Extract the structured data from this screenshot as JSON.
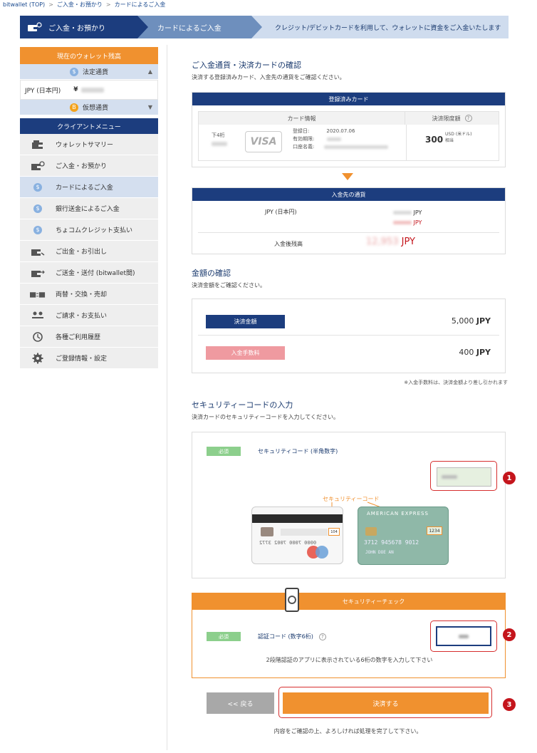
{
  "breadcrumb": {
    "items": [
      "bitwallet (TOP)",
      "ご入金・お預かり",
      "カードによるご入金"
    ]
  },
  "steps": {
    "step1": "ご入金・お預かり",
    "step2": "カードによるご入金",
    "step3": "クレジット/デビットカードを利用して、ウォレットに資金をご入金いたします"
  },
  "sidebar": {
    "balance_title": "現在のウォレット残高",
    "fiat_label": "法定通貨",
    "fiat_currency": "JPY (日本円)",
    "fiat_prefix": "¥",
    "crypto_label": "仮想通貨",
    "menu_title": "クライアントメニュー",
    "items": [
      {
        "label": "ウォレットサマリー",
        "icon": "wallet-icon"
      },
      {
        "label": "ご入金・お預かり",
        "icon": "deposit-icon"
      },
      {
        "label": "カードによるご入金",
        "icon": "coin-icon"
      },
      {
        "label": "銀行送金によるご入金",
        "icon": "coin-icon"
      },
      {
        "label": "ちょコムクレジット支払い",
        "icon": "coin-icon"
      },
      {
        "label": "ご出金・お引出し",
        "icon": "withdraw-icon"
      },
      {
        "label": "ご送金・送付 (bitwallet間)",
        "icon": "transfer-icon"
      },
      {
        "label": "両替・交換・売却",
        "icon": "exchange-icon"
      },
      {
        "label": "ご請求・お支払い",
        "icon": "users-icon"
      },
      {
        "label": "各種ご利用履歴",
        "icon": "history-icon"
      },
      {
        "label": "ご登録情報・設定",
        "icon": "gear-icon"
      }
    ]
  },
  "confirm": {
    "title": "ご入金通貨・決済カードの確認",
    "subtitle": "決済する登録済みカード、入金先の通貨をご確認ください。",
    "card_header": "登録済みカード",
    "col_card_info": "カード情報",
    "col_limit": "決済限度額",
    "last4_label": "下4桁",
    "card_brand": "VISA",
    "reg_date_label": "登録日:",
    "reg_date": "2020.07.06",
    "expiry_label": "有効期限:",
    "holder_label": "口座名義:",
    "limit_value": "300",
    "limit_unit": "USD (米ドル)",
    "limit_suffix": "相当",
    "dest_header": "入金先の通貨",
    "dest_currency": "JPY (日本円)",
    "jpy": "JPY",
    "after_label": "入金後残高",
    "after_value": "12,953",
    "after_unit": "JPY"
  },
  "amount": {
    "title": "金額の確認",
    "subtitle": "決済金額をご確認ください。",
    "pay_label": "決済金額",
    "pay_value": "5,000",
    "fee_label": "入金手数料",
    "fee_value": "400",
    "unit": "JPY",
    "note": "※入金手数料は、決済金額より差し引かれます"
  },
  "security": {
    "title": "セキュリティーコードの入力",
    "subtitle": "決済カードのセキュリティーコードを入力してください。",
    "required": "必須",
    "code_label": "セキュリティコード (半角数字)",
    "code_caption": "セキュリティーコード",
    "card1_code": "104",
    "card2_code": "1234",
    "amex_text": "AMERICAN EXPRESS",
    "card1_number": "0000 7000 7002 3772",
    "card2_number": "3712 945678 9012",
    "card2_name": "JOHN DOE AN"
  },
  "check": {
    "title": "セキュリティーチェック",
    "required": "必須",
    "auth_label": "認証コード (数字6桁)",
    "instruction": "2段階認証のアプリに表示されている6桁の数字を入力して下さい"
  },
  "actions": {
    "back": "<< 戻る",
    "submit": "決済する",
    "footer": "内容をご確認の上、よろしければ処理を完了して下さい。"
  },
  "markers": [
    "1",
    "2",
    "3"
  ]
}
